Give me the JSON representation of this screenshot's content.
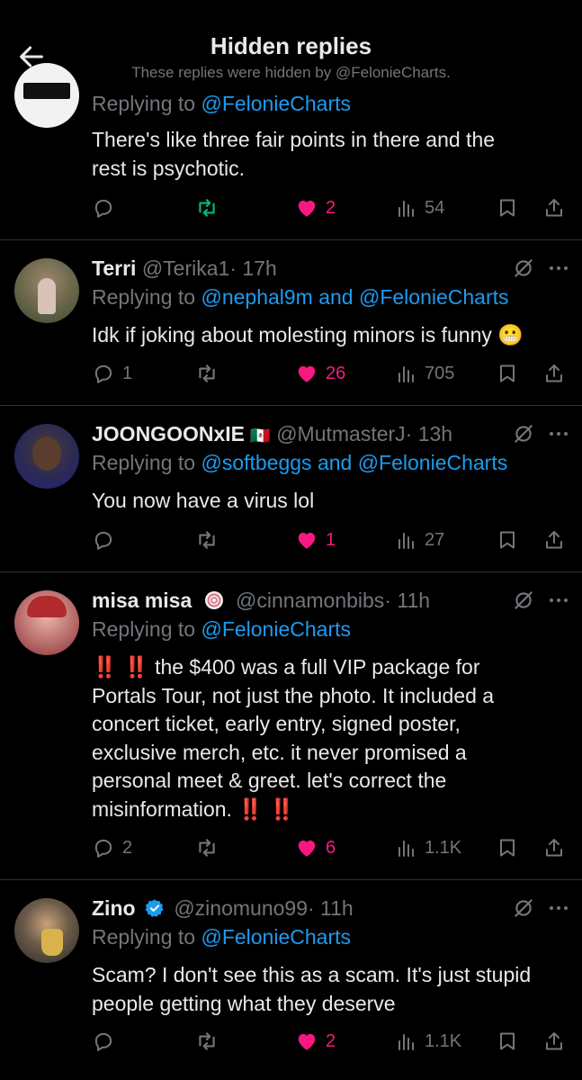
{
  "header": {
    "title": "Hidden replies",
    "subtitle": "These replies were hidden by @FelonieCharts."
  },
  "tweets": [
    {
      "replying_prefix": "Replying to",
      "replying_to": "@FelonieCharts",
      "lines": [
        "There's like three fair points in there and the",
        "rest is psychotic."
      ],
      "replies": "",
      "retweets_active": true,
      "likes": "2",
      "views": "54"
    },
    {
      "name": "Terri",
      "handle": "@Terika1",
      "time": "· 17h",
      "replying_prefix": "Replying to",
      "replying_to": "@nephal9m and @FelonieCharts",
      "lines": [
        "Idk if joking about molesting minors is funny 😬"
      ],
      "replies": "1",
      "likes": "26",
      "views": "705"
    },
    {
      "name": "JOONGOONxIE",
      "flag": "🇲🇽",
      "handle": "@MutmasterJ",
      "time": "· 13h",
      "replying_prefix": "Replying to",
      "replying_to": "@softbeggs and @FelonieCharts",
      "lines": [
        "You now have a virus lol"
      ],
      "replies": "",
      "likes": "1",
      "views": "27"
    },
    {
      "name": "misa misa",
      "handle": "@cinnamonbibs",
      "time": "· 11h",
      "replying_prefix": "Replying to",
      "replying_to": "@FelonieCharts",
      "emphasis": "‼️",
      "lines": [
        "the $400 was a full VIP package for",
        "Portals Tour, not just the photo. It included a",
        "concert ticket, early entry, signed poster,",
        "exclusive merch, etc. it never promised a",
        "personal meet & greet.  let's correct the",
        "misinformation."
      ],
      "replies": "2",
      "likes": "6",
      "views": "1.1K"
    },
    {
      "name": "Zino",
      "handle": "@zinomuno99",
      "time": "· 11h",
      "replying_prefix": "Replying to",
      "replying_to": "@FelonieCharts",
      "lines": [
        "Scam? I don't see this as a scam. It's just stupid",
        "people getting what they deserve"
      ],
      "replies": "",
      "likes": "2",
      "views": "1.1K"
    }
  ],
  "colors": {
    "background": "#000000",
    "text": "#e7e9ea",
    "secondary": "#71767b",
    "link": "#1d9bf0",
    "like": "#f91880",
    "retweet_active": "#00ba7c",
    "divider": "#2f3336",
    "emphasis": "#e0245e"
  }
}
